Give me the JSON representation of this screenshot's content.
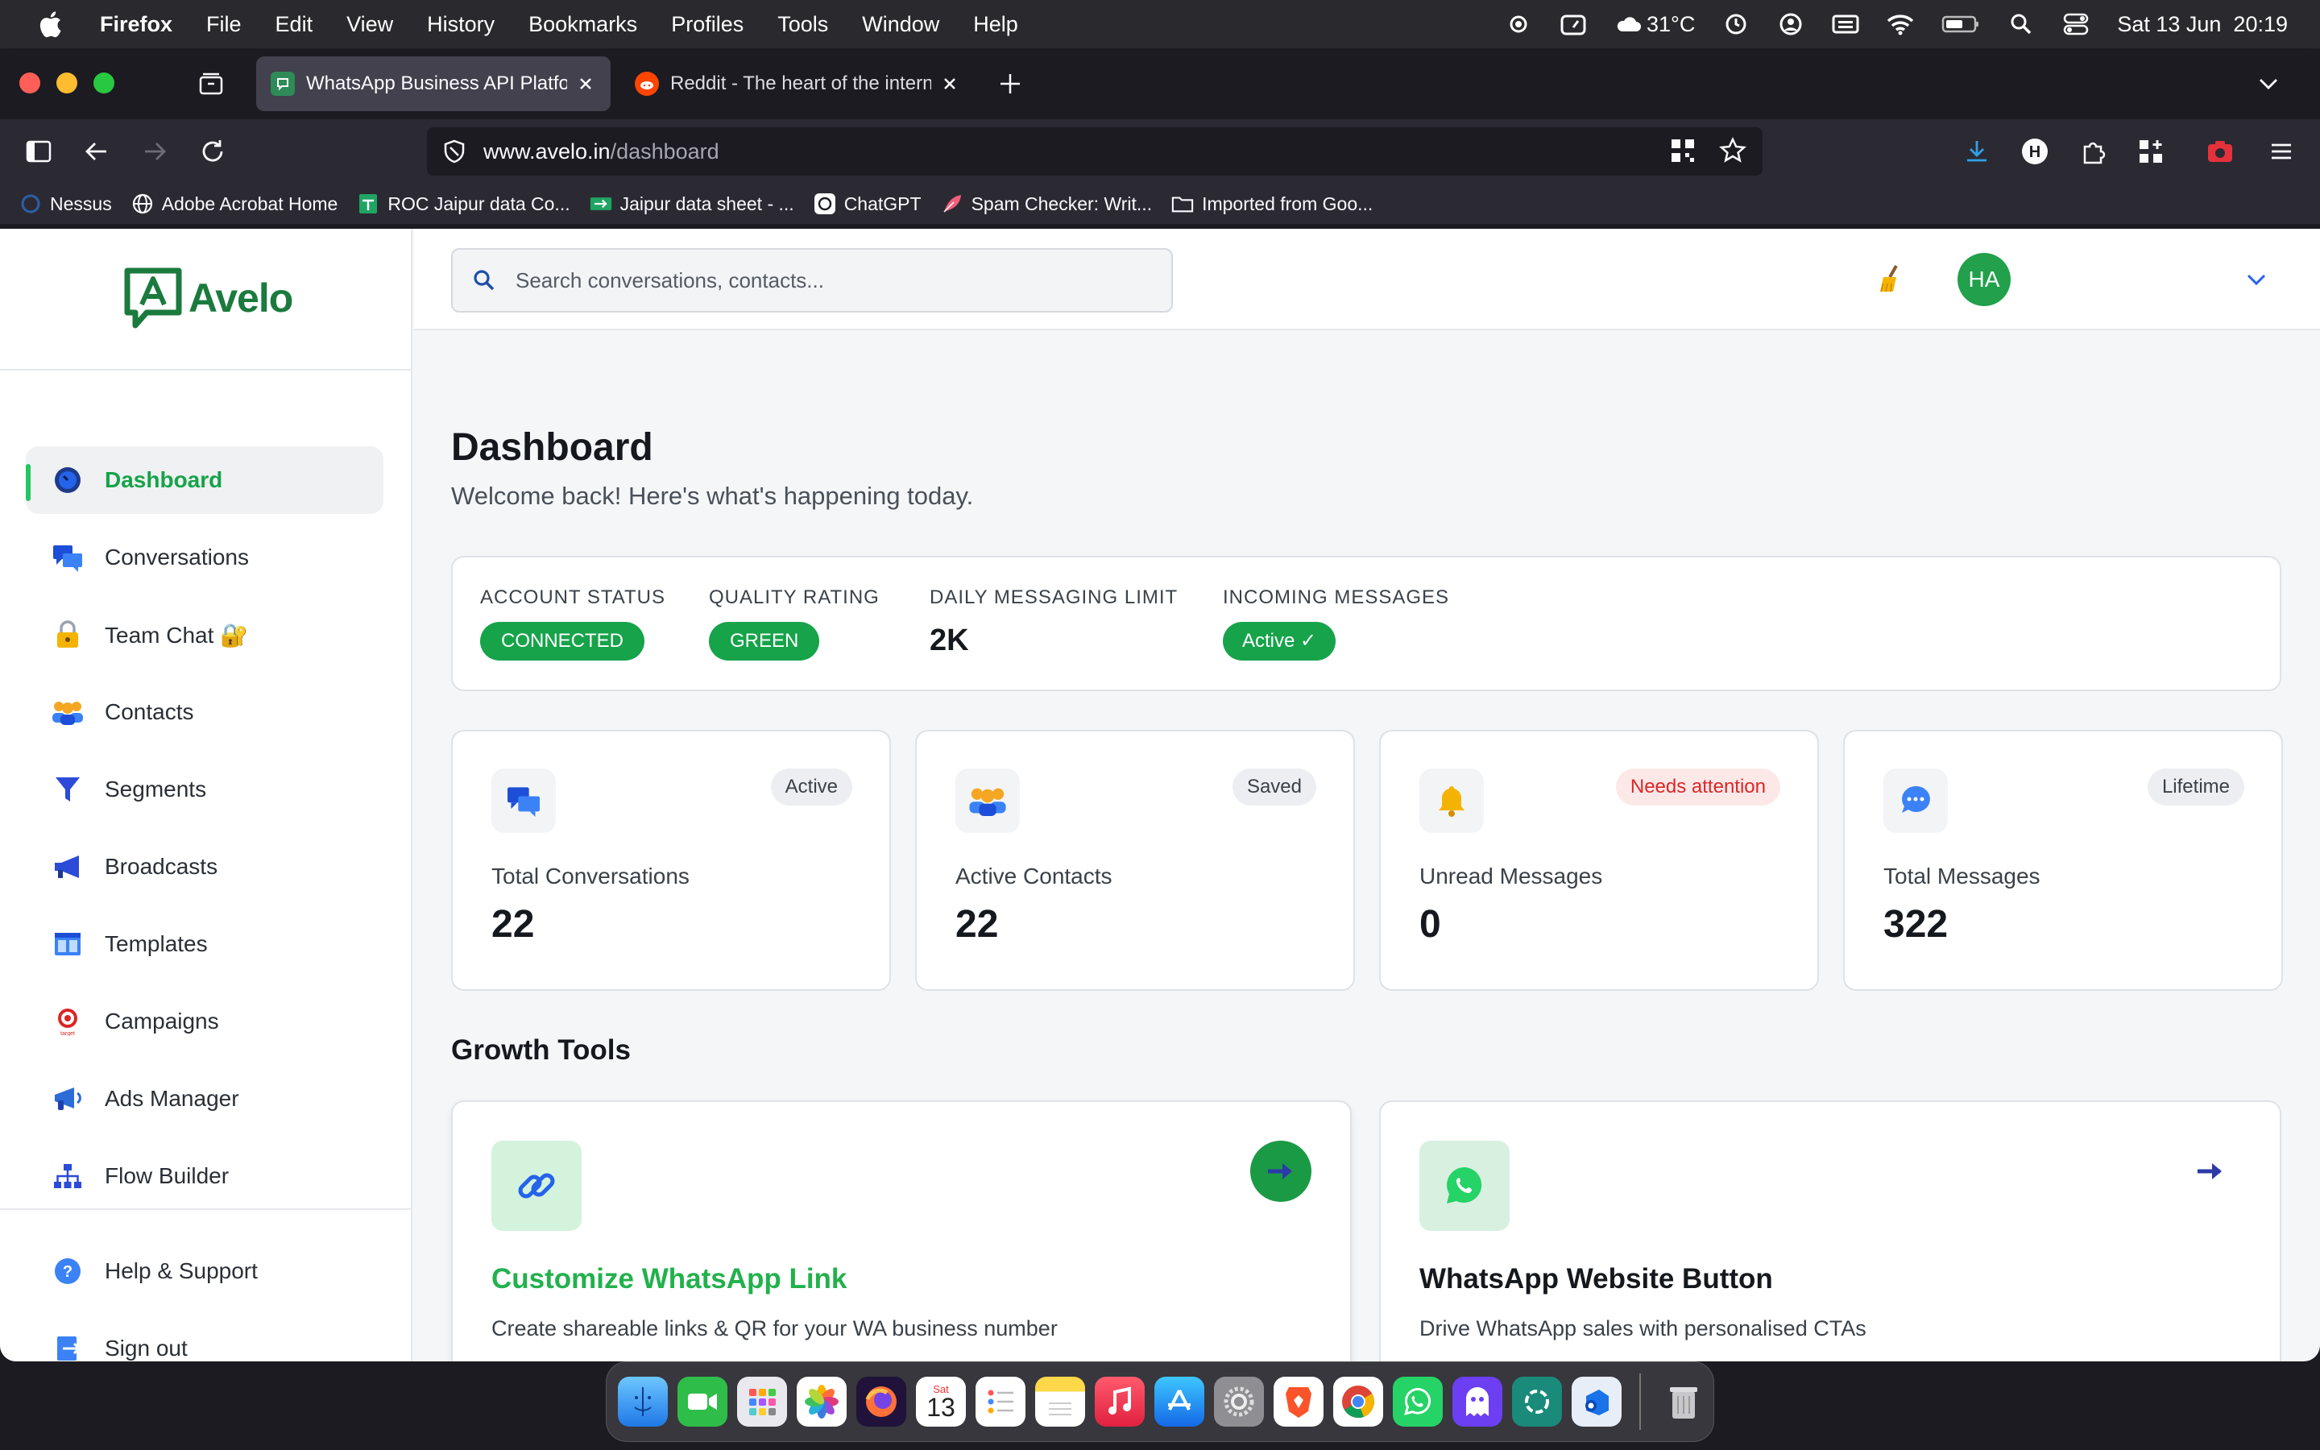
{
  "menubar": {
    "app_name": "Firefox",
    "menus": [
      "File",
      "Edit",
      "View",
      "History",
      "Bookmarks",
      "Profiles",
      "Tools",
      "Window",
      "Help"
    ],
    "weather": "31°C",
    "datetime": "Sat 13 Jun  20:19"
  },
  "browser": {
    "tabs": [
      {
        "title": "WhatsApp Business API Platform",
        "favicon": "avelo-favicon",
        "active": true
      },
      {
        "title": "Reddit - The heart of the internet",
        "favicon": "reddit-favicon",
        "active": false
      }
    ],
    "url_host": "www.avelo.in",
    "url_path": "/dashboard",
    "bookmarks": [
      {
        "label": "Nessus",
        "icon": "nessus-icon"
      },
      {
        "label": "Adobe Acrobat Home",
        "icon": "globe-icon"
      },
      {
        "label": "ROC Jaipur data Co...",
        "icon": "sheets-icon"
      },
      {
        "label": "Jaipur data sheet - ...",
        "icon": "sheets-arrow-icon"
      },
      {
        "label": "ChatGPT",
        "icon": "chatgpt-icon"
      },
      {
        "label": "Spam Checker: Writ...",
        "icon": "feather-icon"
      },
      {
        "label": "Imported from Goo...",
        "icon": "folder-icon"
      }
    ]
  },
  "sidebar": {
    "brand": "Avelo",
    "items": [
      {
        "label": "Dashboard",
        "icon": "dashboard-icon",
        "active": true
      },
      {
        "label": "Conversations",
        "icon": "chat-bubbles-icon"
      },
      {
        "label": "Team Chat 🔐",
        "icon": "lock-icon"
      },
      {
        "label": "Contacts",
        "icon": "people-icon"
      },
      {
        "label": "Segments",
        "icon": "funnel-icon"
      },
      {
        "label": "Broadcasts",
        "icon": "megaphone-icon"
      },
      {
        "label": "Templates",
        "icon": "template-icon"
      },
      {
        "label": "Campaigns",
        "icon": "target-icon"
      },
      {
        "label": "Ads Manager",
        "icon": "loudspeaker-icon"
      },
      {
        "label": "Flow Builder",
        "icon": "sitemap-icon"
      }
    ],
    "footer_items": [
      {
        "label": "Help & Support",
        "icon": "question-icon"
      },
      {
        "label": "Sign out",
        "icon": "sign-out-icon"
      }
    ]
  },
  "topbar": {
    "search_placeholder": "Search conversations, contacts...",
    "avatar_initials": "HA"
  },
  "main": {
    "title": "Dashboard",
    "subtitle": "Welcome back! Here's what's happening today.",
    "status": {
      "account_status_label": "ACCOUNT STATUS",
      "account_status_value": "CONNECTED",
      "quality_rating_label": "QUALITY RATING",
      "quality_rating_value": "GREEN",
      "daily_limit_label": "DAILY MESSAGING LIMIT",
      "daily_limit_value": "2K",
      "incoming_label": "INCOMING MESSAGES",
      "incoming_value": "Active ✓"
    },
    "stats": [
      {
        "label": "Total Conversations",
        "value": "22",
        "badge": "Active",
        "icon": "chat-bubbles-icon"
      },
      {
        "label": "Active Contacts",
        "value": "22",
        "badge": "Saved",
        "icon": "people-icon"
      },
      {
        "label": "Unread Messages",
        "value": "0",
        "badge": "Needs attention",
        "icon": "bell-icon"
      },
      {
        "label": "Total Messages",
        "value": "322",
        "badge": "Lifetime",
        "icon": "speech-dots-icon"
      }
    ],
    "growth_title": "Growth Tools",
    "tools": [
      {
        "title": "Customize WhatsApp Link",
        "desc": "Create shareable links & QR for your WA business number",
        "icon": "link-icon"
      },
      {
        "title": "WhatsApp Website Button",
        "desc": "Drive WhatsApp sales with personalised CTAs",
        "icon": "whatsapp-icon"
      }
    ]
  },
  "dock": {
    "calendar_day": "13",
    "calendar_month": "Sat"
  },
  "colors": {
    "brand_green": "#16a34a",
    "logo_green": "#1b7a3e",
    "alert_red": "#dc2626",
    "arrow_blue": "#2b3aa8"
  }
}
